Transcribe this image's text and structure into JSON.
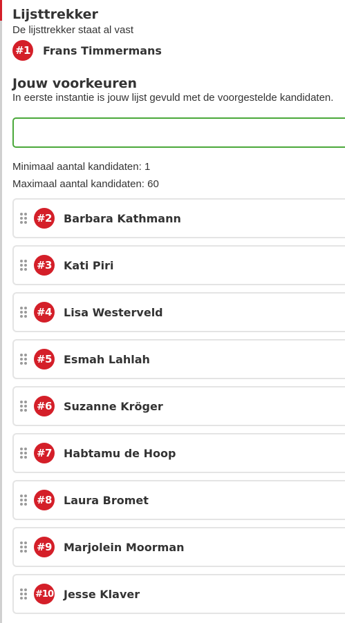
{
  "leader_section": {
    "title": "Lijsttrekker",
    "subtitle": "De lijsttrekker staat al vast",
    "leader": {
      "rank": "#1",
      "name": "Frans Timmermans"
    }
  },
  "preferences_section": {
    "title": "Jouw voorkeuren",
    "subtitle": "In eerste instantie is jouw lijst gevuld met de voorgestelde kandidaten.",
    "search": {
      "value": "",
      "placeholder": ""
    },
    "min_text": "Minimaal aantal kandidaten: 1",
    "max_text": "Maximaal aantal kandidaten: 60"
  },
  "candidates": [
    {
      "rank": "#2",
      "name": "Barbara Kathmann"
    },
    {
      "rank": "#3",
      "name": "Kati Piri"
    },
    {
      "rank": "#4",
      "name": "Lisa Westerveld"
    },
    {
      "rank": "#5",
      "name": "Esmah Lahlah"
    },
    {
      "rank": "#6",
      "name": "Suzanne Kröger"
    },
    {
      "rank": "#7",
      "name": "Habtamu de Hoop"
    },
    {
      "rank": "#8",
      "name": "Laura Bromet"
    },
    {
      "rank": "#9",
      "name": "Marjolein Moorman"
    },
    {
      "rank": "#10",
      "name": "Jesse Klaver"
    }
  ],
  "colors": {
    "accent_red": "#d41f29",
    "input_border_green": "#4aa83a",
    "card_border": "#e4e4e4"
  },
  "icons": {
    "drag_handle": "drag-handle-icon"
  }
}
